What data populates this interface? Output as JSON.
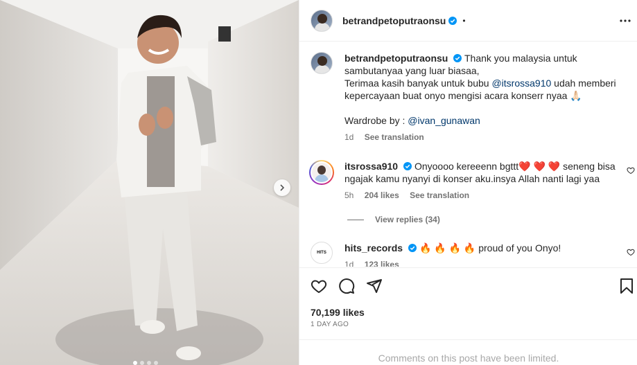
{
  "post": {
    "username": "betrandpetoputraonsu",
    "more_label": "•"
  },
  "caption": {
    "username": "betrandpetoputraonsu",
    "line1": "Thank you malaysia untuk sambutanyaa yang luar biasaa,",
    "line2_pre": "Terimaa kasih banyak untuk bubu",
    "line2_mention": "@itsrossa910",
    "line2_post": "udah memberi kepercayaan buat onyo mengisi acara konserr nyaa 🙏🏻",
    "wardrobe_pre": "Wardrobe by :",
    "wardrobe_mention": "@ivan_gunawan",
    "time": "1d",
    "see_translation": "See translation"
  },
  "comments": [
    {
      "username": "itsrossa910",
      "text": "Onyoooo kereeenn bgttt❤️ ❤️ ❤️  seneng bisa ngajak kamu nyanyi di konser aku.insya Allah nanti lagi yaa",
      "time": "5h",
      "likes": "204 likes",
      "see_translation": "See translation",
      "view_replies": "View replies (34)"
    },
    {
      "username": "hits_records",
      "text": "🔥 🔥 🔥 🔥 proud of you Onyo!",
      "time": "1d",
      "likes": "123 likes",
      "avatar_text": "HITS"
    }
  ],
  "stats": {
    "likes": "70,199 likes",
    "ago": "1 DAY AGO"
  },
  "footer": {
    "limited": "Comments on this post have been limited."
  },
  "carousel": {
    "count": 4,
    "active": 0
  },
  "colors": {
    "verified": "#0095f6",
    "mention": "#00376b",
    "muted": "#737373"
  }
}
